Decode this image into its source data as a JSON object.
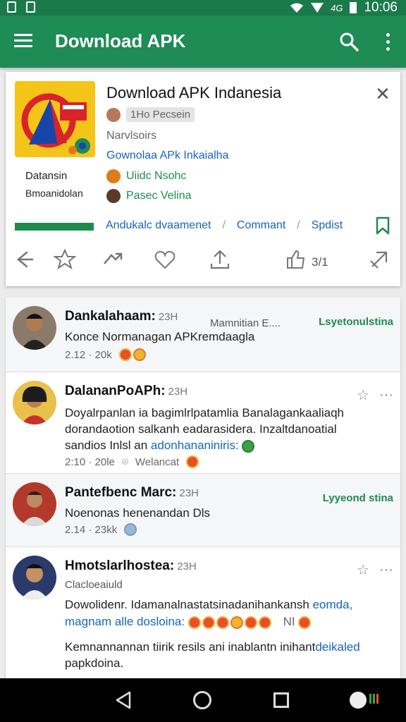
{
  "status": {
    "time": "10:06",
    "signal": "4G"
  },
  "appbar": {
    "title": "Download APK"
  },
  "card": {
    "title": "Download APK Indanesia",
    "pill": "1Ho Pecsein",
    "line1": "Narvlsoirs",
    "line2": "Gownolaa APk Inkaialha",
    "user1": "Uiidc Nsohc",
    "user2": "Pasec Velina",
    "side1": "Datansin",
    "side2": "Bmoanidolan",
    "links": [
      "Andukalc dvaamenet",
      "Commant",
      "Spdist"
    ],
    "count": "3/1"
  },
  "posts": [
    {
      "name": "Dankalahaam:",
      "time": "23H",
      "text": "Konce Normanagan APKremdaagla",
      "stats": "2.12 · 20k",
      "extra": "Mamnitian E....",
      "follow": "Lsyetonulstina"
    },
    {
      "name": "DalananPoAPh:",
      "time": "23H",
      "text1": "Doyalrpanlan ia bagimlrlpatamlia Banalagankaaliaqh",
      "text2": "dorandaotion salkanh eadarasidera. Inzaltdanoatial",
      "text3a": "sandios Inlsl an",
      "text3b": "adonhananiniris:",
      "stats": "2:10 · 20le",
      "loc": "Welancat"
    },
    {
      "name": "Pantefbenc Marc:",
      "time": "23H",
      "text": "Noenonas henenandan Dls",
      "stats": "2.14 · 23kk",
      "follow": "Lyyeond stina"
    },
    {
      "name": "Hmotslarlhostea:",
      "time": "23H",
      "sub": "Clacloeaiuld",
      "text1a": "Dowolidenr. Idamanalnastatsinadanihankansh",
      "text1b": "eomda,",
      "text2": "magnam alle dosloina:",
      "textn": "NI",
      "text3a": "Kemnannannan tiirik resils ani inablantn inihant",
      "text3b": "deikaled",
      "text4": "papkdoina."
    }
  ],
  "colors": {
    "primary": "#1f8b55",
    "link": "#1565c0",
    "accent_green": "#1e8b4d"
  }
}
